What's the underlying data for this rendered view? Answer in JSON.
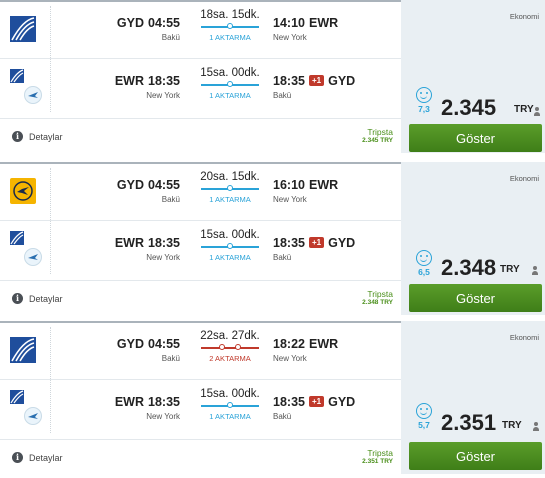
{
  "results": [
    {
      "cabin": "Ekonomi",
      "outbound": {
        "airline_icon": "united-airlines-logo",
        "from_code": "GYD",
        "dep_time": "04:55",
        "from_city": "Bakü",
        "duration": "18sa. 15dk.",
        "stops": "1 AKTARMA",
        "stops_color": "#2aa3d8",
        "arr_time": "14:10",
        "to_code": "EWR",
        "to_city": "New York",
        "plus_day": ""
      },
      "inbound": {
        "airline_icon": "united-airlines-logo",
        "from_code": "EWR",
        "dep_time": "18:35",
        "from_city": "New York",
        "duration": "15sa. 00dk.",
        "stops": "1 AKTARMA",
        "stops_color": "#2aa3d8",
        "arr_time": "18:35",
        "to_code": "GYD",
        "to_city": "Bakü",
        "plus_day": "+1"
      },
      "score": "7,3",
      "price": "2.345",
      "currency": "TRY",
      "provider": "Tripsta",
      "provider_price": "2.345 TRY",
      "details_label": "Detaylar",
      "button_label": "Göster"
    },
    {
      "cabin": "Ekonomi",
      "outbound": {
        "airline_icon": "lufthansa-logo",
        "from_code": "GYD",
        "dep_time": "04:55",
        "from_city": "Bakü",
        "duration": "20sa. 15dk.",
        "stops": "1 AKTARMA",
        "stops_color": "#2aa3d8",
        "arr_time": "16:10",
        "to_code": "EWR",
        "to_city": "New York",
        "plus_day": ""
      },
      "inbound": {
        "airline_icon": "united-airlines-logo",
        "from_code": "EWR",
        "dep_time": "18:35",
        "from_city": "New York",
        "duration": "15sa. 00dk.",
        "stops": "1 AKTARMA",
        "stops_color": "#2aa3d8",
        "arr_time": "18:35",
        "to_code": "GYD",
        "to_city": "Bakü",
        "plus_day": "+1"
      },
      "score": "6,5",
      "price": "2.348",
      "currency": "TRY",
      "provider": "Tripsta",
      "provider_price": "2.348 TRY",
      "details_label": "Detaylar",
      "button_label": "Göster"
    },
    {
      "cabin": "Ekonomi",
      "outbound": {
        "airline_icon": "united-airlines-logo",
        "from_code": "GYD",
        "dep_time": "04:55",
        "from_city": "Bakü",
        "duration": "22sa. 27dk.",
        "stops": "2 AKTARMA",
        "stops_color": "#c0392b",
        "arr_time": "18:22",
        "to_code": "EWR",
        "to_city": "New York",
        "plus_day": ""
      },
      "inbound": {
        "airline_icon": "united-airlines-logo",
        "from_code": "EWR",
        "dep_time": "18:35",
        "from_city": "New York",
        "duration": "15sa. 00dk.",
        "stops": "1 AKTARMA",
        "stops_color": "#2aa3d8",
        "arr_time": "18:35",
        "to_code": "GYD",
        "to_city": "Bakü",
        "plus_day": "+1"
      },
      "score": "5,7",
      "price": "2.351",
      "currency": "TRY",
      "provider": "Tripsta",
      "provider_price": "2.351 TRY",
      "details_label": "Detaylar",
      "button_label": "Göster"
    }
  ]
}
